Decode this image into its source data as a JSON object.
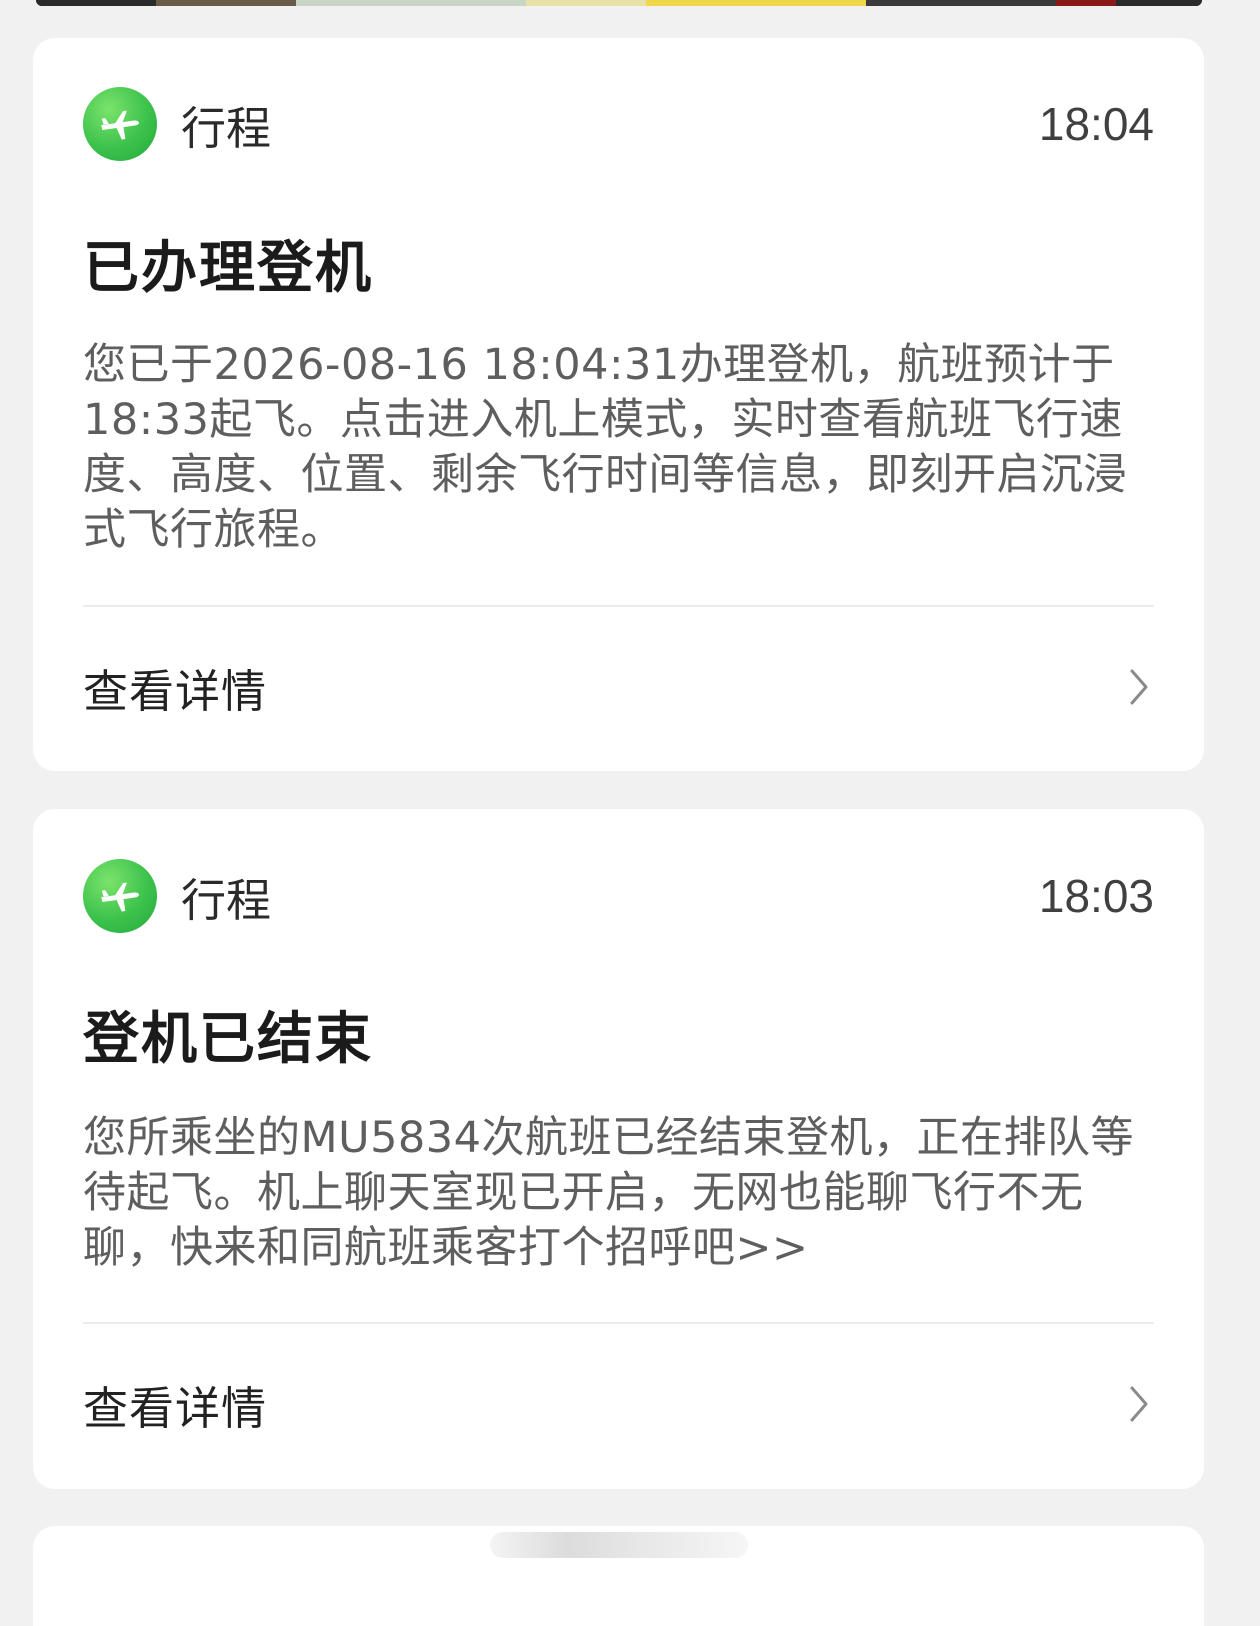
{
  "top_strip": {
    "colors": [
      "#2a2a2a",
      "#6a5a48",
      "#c9d6c6",
      "#e8e2a8",
      "#f0d64a",
      "#3a3a3a",
      "#8a1a1a",
      "#2a2a2a"
    ]
  },
  "notifications": [
    {
      "app_icon": "airplane-icon",
      "app_name": "行程",
      "time": "18:04",
      "title": "已办理登机",
      "body": "您已于2026-08-16 18:04:31办理登机，航班预计于18:33起飞。点击进入机上模式，实时查看航班飞行速度、高度、位置、剩余飞行时间等信息，即刻开启沉浸式飞行旅程。",
      "detail_label": "查看详情",
      "detail_icon": "chevron-right-icon"
    },
    {
      "app_icon": "airplane-icon",
      "app_name": "行程",
      "time": "18:03",
      "title": "登机已结束",
      "body": "您所乘坐的MU5834次航班已经结束登机，正在排队等待起飞。机上聊天室现已开启，无网也能聊飞行不无聊，快来和同航班乘客打个招呼吧>>",
      "detail_label": "查看详情",
      "detail_icon": "chevron-right-icon"
    }
  ],
  "colors": {
    "background": "#f1f1f1",
    "card": "#ffffff",
    "icon_green": "#3cc24c",
    "body_text": "#5e5e5e"
  }
}
